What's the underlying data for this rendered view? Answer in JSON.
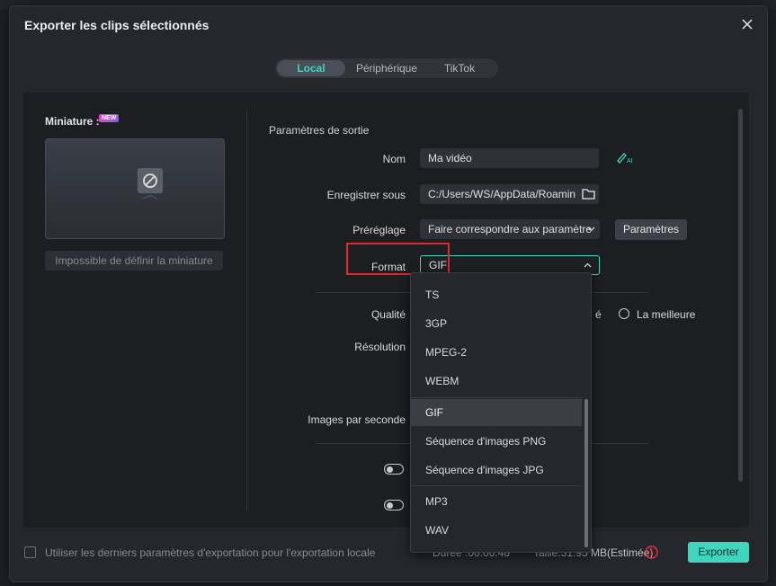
{
  "dialog": {
    "title": "Exporter les clips sélectionnés"
  },
  "tabs": [
    "Local",
    "Périphérique",
    "TikTok"
  ],
  "thumbnail": {
    "label": "Miniature :",
    "badge": "NEW",
    "button": "Impossible de définir la miniature"
  },
  "output": {
    "section_title": "Paramètres de sortie",
    "name_label": "Nom",
    "name_value": "Ma vidéo",
    "save_label": "Enregistrer sous",
    "save_value": "C:/Users/WS/AppData/Roamin",
    "preset_label": "Préréglage",
    "preset_value": "Faire correspondre aux paramètre",
    "params_button": "Paramètres",
    "format_label": "Format",
    "format_value": "GIF",
    "quality_label": "Qualité",
    "quality_partial": "é",
    "quality_best": "La meilleure",
    "resolution_label": "Résolution",
    "fps_label": "Images par seconde"
  },
  "format_options": [
    {
      "label": "TS"
    },
    {
      "label": "3GP"
    },
    {
      "label": "MPEG-2"
    },
    {
      "label": "WEBM"
    },
    {
      "label": "GIF",
      "selected": true
    },
    {
      "label": "Séquence d'images PNG"
    },
    {
      "label": "Séquence d'images JPG"
    },
    {
      "label": "MP3"
    },
    {
      "label": "WAV"
    }
  ],
  "footer": {
    "checkbox_label": "Utiliser les derniers paramètres d'exportation pour l'exportation locale",
    "duration": "Durée :00:00:48",
    "size": "Taille:31.95 MB(Estimée)",
    "export_button": "Exporter"
  },
  "colors": {
    "accent": "#3fd6bd",
    "highlight_box": "#e0262f",
    "warning": "#e0363c"
  }
}
